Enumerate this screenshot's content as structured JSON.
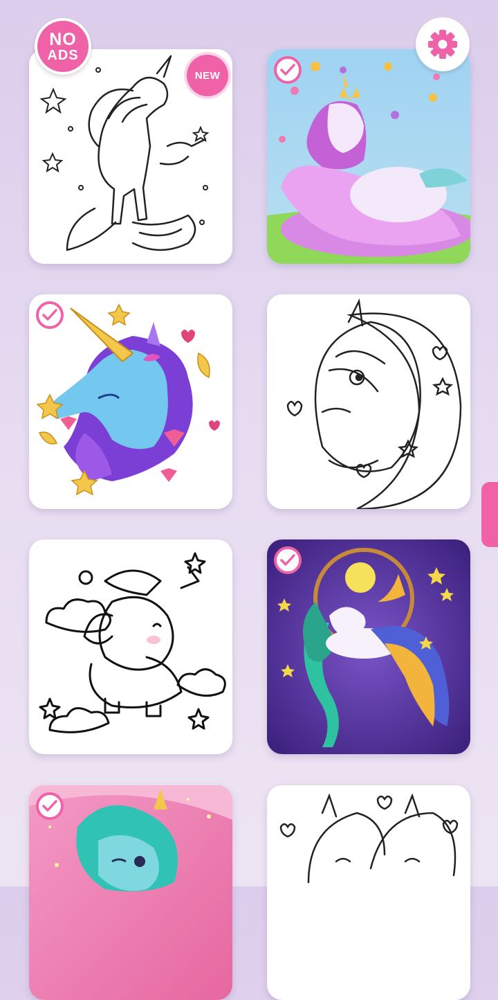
{
  "header": {
    "no_ads_line1": "NO",
    "no_ads_line2": "ADS"
  },
  "gallery": {
    "new_badge": "NEW",
    "items": [
      {
        "name": "rearing-unicorn-outline",
        "state": "new"
      },
      {
        "name": "winged-princess-pony",
        "state": "completed"
      },
      {
        "name": "blue-unicorn-head",
        "state": "completed"
      },
      {
        "name": "moon-unicorn-outline",
        "state": "uncolored"
      },
      {
        "name": "sleepy-cloud-unicorn-outline",
        "state": "uncolored"
      },
      {
        "name": "moon-swing-pegasus",
        "state": "completed"
      },
      {
        "name": "teal-winking-unicorn",
        "state": "completed"
      },
      {
        "name": "unicorn-couple-outline",
        "state": "uncolored"
      }
    ]
  },
  "colors": {
    "accent": "#f062a8",
    "background": "#e2d6ef",
    "card": "#ffffff"
  }
}
